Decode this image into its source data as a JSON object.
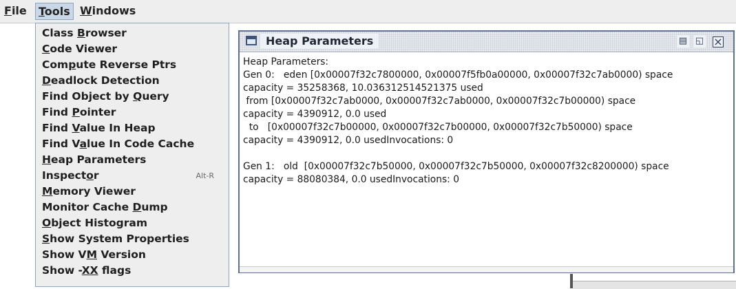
{
  "menubar": {
    "file_mnemonic": "F",
    "file_rest": "ile",
    "tools_mnemonic": "T",
    "tools_rest": "ools",
    "windows_mnemonic": "W",
    "windows_rest": "indows"
  },
  "tools_menu": {
    "items": [
      {
        "pre": "Class ",
        "mn": "B",
        "post": "rowser"
      },
      {
        "pre": "",
        "mn": "C",
        "post": "ode Viewer"
      },
      {
        "pre": "Com",
        "mn": "p",
        "post": "ute Reverse Ptrs"
      },
      {
        "pre": "",
        "mn": "D",
        "post": "eadlock Detection"
      },
      {
        "pre": "Find Object by ",
        "mn": "Q",
        "post": "uery"
      },
      {
        "pre": "Find ",
        "mn": "P",
        "post": "ointer"
      },
      {
        "pre": "Find ",
        "mn": "V",
        "post": "alue In Heap"
      },
      {
        "pre": "Find V",
        "mn": "a",
        "post": "lue In Code Cache"
      },
      {
        "pre": "",
        "mn": "H",
        "post": "eap Parameters"
      },
      {
        "pre": "Inspect",
        "mn": "o",
        "post": "r",
        "accel": "Alt-R"
      },
      {
        "pre": "",
        "mn": "M",
        "post": "emory Viewer"
      },
      {
        "pre": "Monitor Cache ",
        "mn": "D",
        "post": "ump"
      },
      {
        "pre": "",
        "mn": "O",
        "post": "bject Histogram"
      },
      {
        "pre": "",
        "mn": "S",
        "post": "how System Properties"
      },
      {
        "pre": "Show V",
        "mn": "M",
        "post": " Version"
      },
      {
        "pre": "Show -",
        "mn": "XX",
        "post": " flags"
      }
    ]
  },
  "frame": {
    "title": "Heap Parameters",
    "lines": [
      "Heap Parameters:",
      "Gen 0:   eden [0x00007f32c7800000, 0x00007f5fb0a00000, 0x00007f32c7ab0000) space",
      "capacity = 35258368, 10.036312514521375 used",
      " from [0x00007f32c7ab0000, 0x00007f32c7ab0000, 0x00007f32c7b00000) space",
      "capacity = 4390912, 0.0 used",
      "  to   [0x00007f32c7b00000, 0x00007f32c7b00000, 0x00007f32c7b50000) space",
      "capacity = 4390912, 0.0 usedInvocations: 0",
      "",
      "Gen 1:   old  [0x00007f32c7b50000, 0x00007f32c7b50000, 0x00007f32c8200000) space",
      "capacity = 88080384, 0.0 usedInvocations: 0"
    ]
  }
}
